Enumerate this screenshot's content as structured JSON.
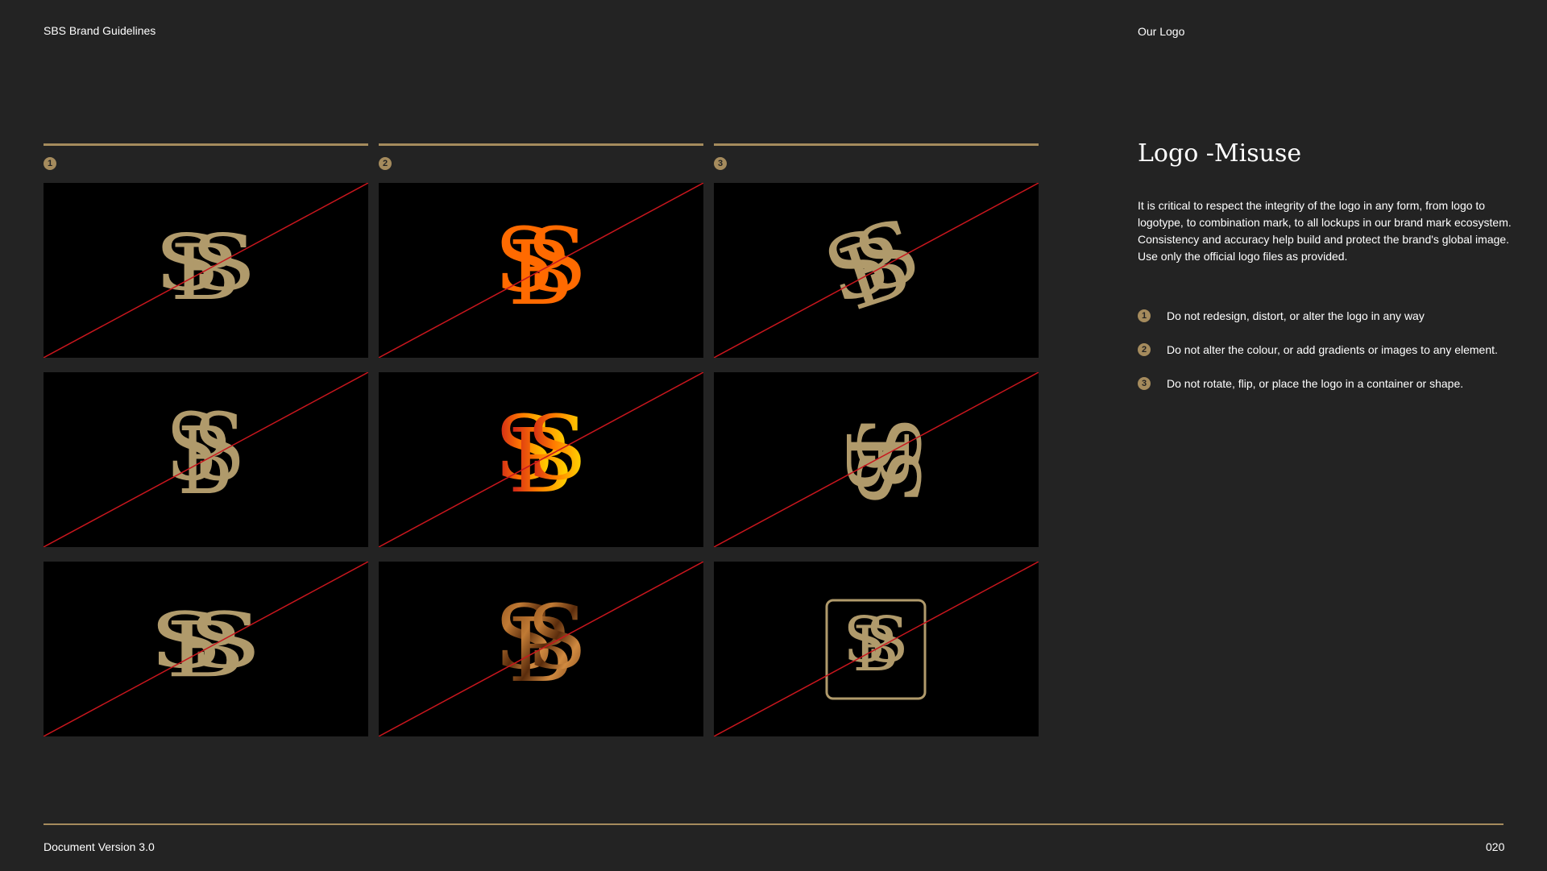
{
  "header": {
    "doc_title": "SBS Brand Guidelines",
    "section": "Our Logo"
  },
  "columns": [
    {
      "number": "1"
    },
    {
      "number": "2"
    },
    {
      "number": "3"
    }
  ],
  "colors": {
    "gold": "#a58b5d",
    "logo_gold": "#b09a6b",
    "orange": "#ff6a00",
    "strike_red": "#c8161d",
    "background": "#232323",
    "panel": "#000000"
  },
  "logo_text": "SBS",
  "misuse_examples": [
    {
      "variant": "stretched",
      "color": "gold"
    },
    {
      "variant": "recolored",
      "color": "orange"
    },
    {
      "variant": "rotated",
      "color": "gold"
    },
    {
      "variant": "condensed",
      "color": "gold"
    },
    {
      "variant": "gradient",
      "color": "orange-yellow"
    },
    {
      "variant": "flipped",
      "color": "gold"
    },
    {
      "variant": "widened",
      "color": "gold"
    },
    {
      "variant": "image-fill",
      "color": "wood"
    },
    {
      "variant": "contained",
      "color": "gold"
    }
  ],
  "content": {
    "title": "Logo -Misuse",
    "description": "It is critical to respect the integrity of the logo in any form, from logo to logotype, to combination mark, to all lockups in our brand mark ecosystem. Consistency and accuracy help build and protect the brand's global image. Use only the official logo files as provided.",
    "rules": [
      {
        "number": "1",
        "text": "Do not redesign, distort, or alter the logo in any way"
      },
      {
        "number": "2",
        "text": "Do not alter the colour, or add gradients or images to any element."
      },
      {
        "number": "3",
        "text": "Do not rotate, flip, or place the logo in a container or shape."
      }
    ]
  },
  "footer": {
    "version": "Document Version 3.0",
    "page": "020"
  }
}
